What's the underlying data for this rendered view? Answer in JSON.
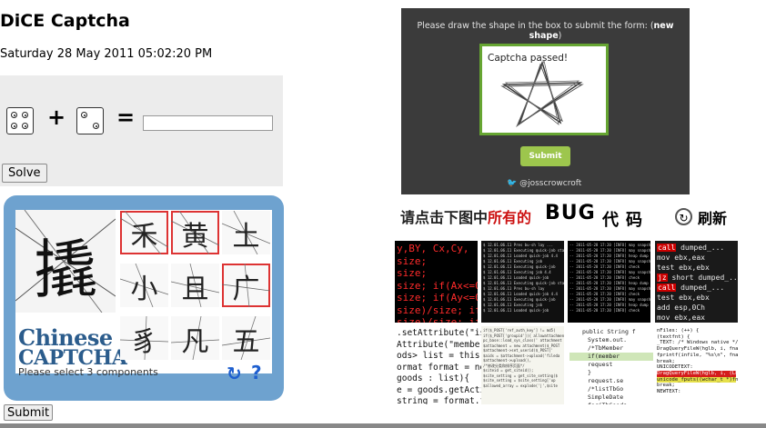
{
  "dice": {
    "title": "DiCE Captcha",
    "date": "Saturday 28 May 2011 05:02:20 PM",
    "operator_plus": "+",
    "operator_equals": "=",
    "answer_value": "",
    "solve_label": "Solve",
    "die_1_value": 4,
    "die_2_value": 2
  },
  "chinese": {
    "big_char": "撬",
    "logo_line_1": "Chinese",
    "logo_line_2": "CAPTCHA",
    "cells": [
      "禾",
      "黄",
      "土",
      "小",
      "且",
      "广",
      "豸",
      "凡",
      "五"
    ],
    "selected": [
      true,
      true,
      false,
      false,
      false,
      true,
      false,
      false,
      false
    ],
    "status": "Please select 3 components",
    "refresh_icon": "↻",
    "help_icon": "?",
    "submit_label": "Submit"
  },
  "shape": {
    "prompt": "Please draw the shape in the box to submit the form: (",
    "prompt_link": "new shape",
    "prompt_end": ")",
    "passed": "Captcha passed!",
    "submit_label": "Submit",
    "credit": "@josscrowcroft",
    "accent": "#66a532"
  },
  "bug": {
    "header_pre": "请点击下图中",
    "header_red": "所有的",
    "word": "BUG",
    "word2": "代码",
    "refresh_label": "刷新",
    "shot_1": [
      "y,BY, Cx,Cy,",
      "size;",
      "size;",
      "",
      "size; if(Ax<=0)",
      "size; if(Ay<=0)",
      "",
      "size)/size; if(Bx<=0",
      "size)/size; if(By<=0"
    ],
    "shot_4": [
      "call dumped_...",
      "mov ebx,eax",
      "test ebx,ebx",
      "jz short dumped_..004E",
      "call dumped_...",
      "test ebx,ebx",
      "add esp,0Ch",
      "mov ebx,eax",
      "jz short dumped_..004E",
      "call dumped_...004E917"
    ],
    "shot_5": [
      ".setAttribute(\"isL",
      "",
      "Attribute(\"member\"",
      "ods> list = this.g",
      "ormat format = new",
      "goods : list){",
      "e = goods.getActi",
      "string = format.fo"
    ],
    "shot_7": [
      "public String f",
      "System.out.",
      "/*TbMember",
      "if(member",
      "request",
      "}",
      "request.se",
      "/*listTbGo",
      "SimpleDate",
      "for(TbGoods",
      "Date da"
    ],
    "shot_8": [
      "nFiles: (++) {",
      "(textfnt) {",
      "_TEXT: /* Windows native */",
      "DragQueryFileW(hglb, i, fname",
      "fprintf(infile, \"%s\\n\", fname",
      "break;",
      "UNICODETEXT:",
      "DragQueryFileW(hglb, i, (LPW",
      "unicode_fputs((wchar_t *)fname",
      "break;",
      "NEWTEXT:"
    ]
  }
}
